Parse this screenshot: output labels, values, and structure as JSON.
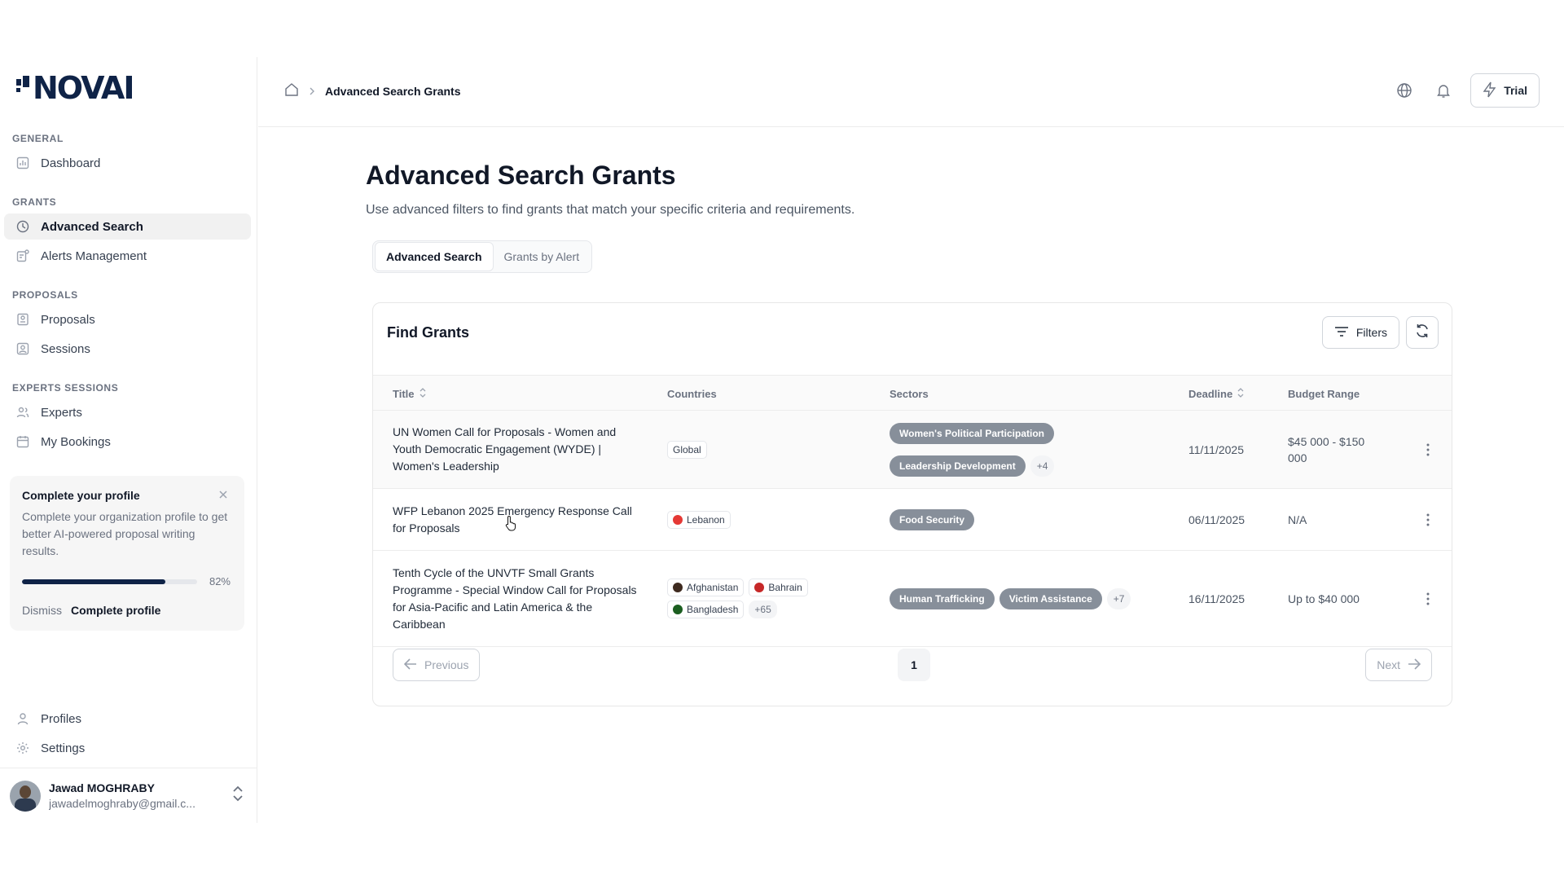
{
  "brand": {
    "name": "NOVAI",
    "color": "#0f2347"
  },
  "sidebar": {
    "sections": [
      {
        "heading": "GENERAL",
        "items": [
          {
            "label": "Dashboard",
            "icon": "chart-icon"
          }
        ]
      },
      {
        "heading": "GRANTS",
        "items": [
          {
            "label": "Advanced Search",
            "icon": "search-clock-icon",
            "active": true
          },
          {
            "label": "Alerts Management",
            "icon": "alert-doc-icon"
          }
        ]
      },
      {
        "heading": "PROPOSALS",
        "items": [
          {
            "label": "Proposals",
            "icon": "document-icon"
          },
          {
            "label": "Sessions",
            "icon": "user-square-icon"
          }
        ]
      },
      {
        "heading": "EXPERTS SESSIONS",
        "items": [
          {
            "label": "Experts",
            "icon": "users-icon"
          },
          {
            "label": "My Bookings",
            "icon": "calendar-icon"
          }
        ]
      }
    ],
    "profile_card": {
      "title": "Complete your profile",
      "description": "Complete your organization profile to get better AI-powered proposal writing results.",
      "progress": 82,
      "progress_label": "82%",
      "dismiss_label": "Dismiss",
      "complete_label": "Complete profile"
    },
    "bottom_items": [
      {
        "label": "Profiles",
        "icon": "user-icon"
      },
      {
        "label": "Settings",
        "icon": "gear-icon"
      }
    ],
    "user": {
      "name": "Jawad MOGHRABY",
      "email": "jawadelmoghraby@gmail.c..."
    }
  },
  "topbar": {
    "breadcrumb": "Advanced Search Grants",
    "trial_label": "Trial"
  },
  "main": {
    "title": "Advanced Search Grants",
    "subtitle": "Use advanced filters to find grants that match your specific criteria and requirements.",
    "tabs": [
      {
        "label": "Advanced Search",
        "active": true
      },
      {
        "label": "Grants by Alert",
        "active": false
      }
    ],
    "card": {
      "title": "Find Grants",
      "filters_label": "Filters",
      "columns": {
        "title": "Title",
        "countries": "Countries",
        "sectors": "Sectors",
        "deadline": "Deadline",
        "budget": "Budget Range"
      },
      "rows": [
        {
          "title": "UN Women Call for Proposals - Women and Youth Democratic Engagement (WYDE) | Women's Leadership",
          "countries": [
            {
              "name": "Global",
              "flag": ""
            }
          ],
          "countries_more": "",
          "sectors": [
            "Women's Political Participation",
            "Leadership Development"
          ],
          "sectors_more": "+4",
          "deadline": "11/11/2025",
          "budget": "$45 000 - $150 000"
        },
        {
          "title": "WFP Lebanon 2025 Emergency Response Call for Proposals",
          "countries": [
            {
              "name": "Lebanon",
              "flag": "#e53935"
            }
          ],
          "countries_more": "",
          "sectors": [
            "Food Security"
          ],
          "sectors_more": "",
          "deadline": "06/11/2025",
          "budget": "N/A"
        },
        {
          "title": "Tenth Cycle of the UNVTF Small Grants Programme - Special Window Call for Proposals for Asia-Pacific and Latin America & the Caribbean",
          "countries": [
            {
              "name": "Afghanistan",
              "flag": "#3e2a1f"
            },
            {
              "name": "Bahrain",
              "flag": "#c62828"
            },
            {
              "name": "Bangladesh",
              "flag": "#1b5e20"
            }
          ],
          "countries_more": "+65",
          "sectors": [
            "Human Trafficking",
            "Victim Assistance"
          ],
          "sectors_more": "+7",
          "deadline": "16/11/2025",
          "budget": "Up to $40 000"
        }
      ],
      "pagination": {
        "previous": "Previous",
        "page": "1",
        "next": "Next"
      }
    }
  }
}
